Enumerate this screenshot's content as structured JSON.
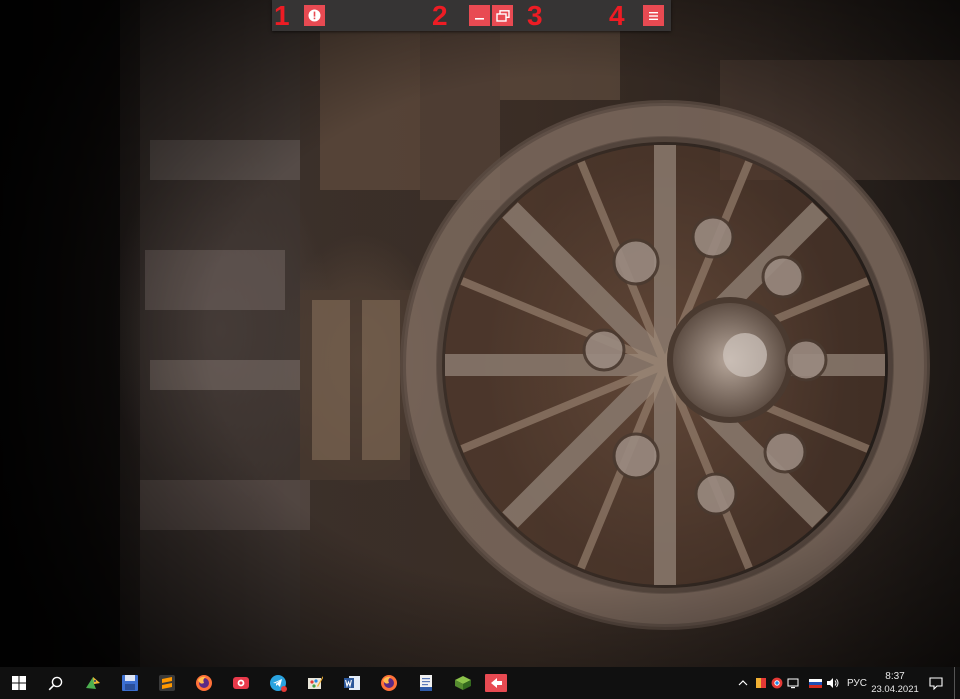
{
  "toolbar": {
    "markers": [
      "1",
      "2",
      "3",
      "4"
    ],
    "buttons": [
      {
        "name": "alert-button",
        "icon": "exclamation-circle-icon"
      },
      {
        "name": "minimize-button",
        "icon": "minimize-icon"
      },
      {
        "name": "restore-button",
        "icon": "restore-window-icon"
      },
      {
        "name": "menu-button",
        "icon": "hamburger-menu-icon"
      }
    ],
    "accent": "#e84a52",
    "marker_color": "#ee1c24"
  },
  "taskbar": {
    "pinned": [
      {
        "name": "start",
        "icon": "windows-logo-icon"
      },
      {
        "name": "search",
        "icon": "search-icon"
      },
      {
        "name": "app-1",
        "icon": "bird-app-icon"
      },
      {
        "name": "app-2",
        "icon": "floppy-disk-icon"
      },
      {
        "name": "app-3",
        "icon": "sublime-text-icon"
      },
      {
        "name": "app-4",
        "icon": "firefox-icon"
      },
      {
        "name": "app-5",
        "icon": "screen-recorder-icon"
      },
      {
        "name": "app-6",
        "icon": "telegram-icon"
      },
      {
        "name": "app-7",
        "icon": "paint-icon"
      },
      {
        "name": "app-8",
        "icon": "word-icon"
      },
      {
        "name": "app-9",
        "icon": "firefox-icon"
      },
      {
        "name": "app-10",
        "icon": "document-viewer-icon"
      },
      {
        "name": "app-11",
        "icon": "package-icon"
      },
      {
        "name": "app-12",
        "icon": "red-arrow-app-icon"
      }
    ],
    "tray": {
      "language": "РУС",
      "time": "8:37",
      "date": "23.04.2021"
    }
  }
}
